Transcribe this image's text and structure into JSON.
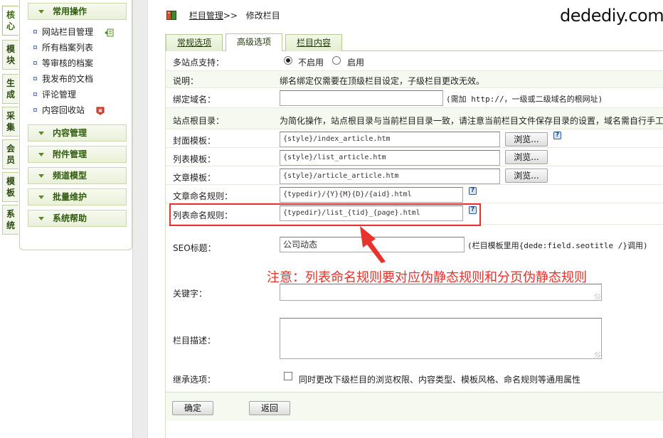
{
  "vtabs": [
    {
      "label": "核心"
    },
    {
      "label": "模块"
    },
    {
      "label": "生成"
    },
    {
      "label": "采集"
    },
    {
      "label": "会员"
    },
    {
      "label": "模板"
    },
    {
      "label": "系统"
    }
  ],
  "menu": {
    "section_common": "常用操作",
    "items": [
      {
        "label": "网站栏目管理"
      },
      {
        "label": "所有档案列表"
      },
      {
        "label": "等审核的档案"
      },
      {
        "label": "我发布的文档"
      },
      {
        "label": "评论管理"
      },
      {
        "label": "内容回收站"
      }
    ],
    "sections": [
      {
        "label": "内容管理"
      },
      {
        "label": "附件管理"
      },
      {
        "label": "频道模型"
      },
      {
        "label": "批量维护"
      },
      {
        "label": "系统帮助"
      }
    ]
  },
  "breadcrumb": {
    "parent": "栏目管理",
    "sep": ">>",
    "current": "修改栏目"
  },
  "watermark": "dedediy.com",
  "tabs": [
    {
      "label": "常规选项"
    },
    {
      "label": "高级选项"
    },
    {
      "label": "栏目内容"
    }
  ],
  "form": {
    "multisite_label": "多站点支持：",
    "multisite_off": "不启用",
    "multisite_on": "启用",
    "desc_label": "说明：",
    "desc_text": "绑名绑定仅需要在顶级栏目设定，子级栏目更改无效。",
    "domain_label": "绑定域名：",
    "domain_value": "",
    "domain_note": "(需加 http://，一级或二级域名的根网址)",
    "siteroot_label": "站点根目录：",
    "siteroot_text": "为简化操作，站点根目录与当前栏目目录一致，请注意当前栏目文件保存目录的设置，域名需自行手工",
    "index_tpl_label": "封面模板：",
    "index_tpl_value": "{style}/index_article.htm",
    "list_tpl_label": "列表模板：",
    "list_tpl_value": "{style}/list_article.htm",
    "article_tpl_label": "文章模板：",
    "article_tpl_value": "{style}/article_article.htm",
    "browse_label": "浏览...",
    "article_rule_label": "文章命名规则：",
    "article_rule_value": "{typedir}/{Y}{M}{D}/{aid}.html",
    "list_rule_label": "列表命名规则：",
    "list_rule_value": "{typedir}/list_{tid}_{page}.html",
    "seo_label": "SEO标题：",
    "seo_value": "公司动态",
    "seo_note": "(栏目模板里用{dede:field.seotitle /}调用)",
    "keywords_label": "关键字：",
    "keywords_value": "",
    "desc_field_label": "栏目描述：",
    "desc_field_value": "",
    "inherit_label": "继承选项：",
    "inherit_text": "同时更改下级栏目的浏览权限、内容类型、模板风格、命名规则等通用属性",
    "help_glyph": "?",
    "ok_label": "确定",
    "back_label": "返回"
  },
  "annotation": "注意：列表命名规则要对应伪静态规则和分页伪静态规则",
  "colors": {
    "accent_green": "#2f5b0e",
    "annotation_red": "#e8322c"
  }
}
